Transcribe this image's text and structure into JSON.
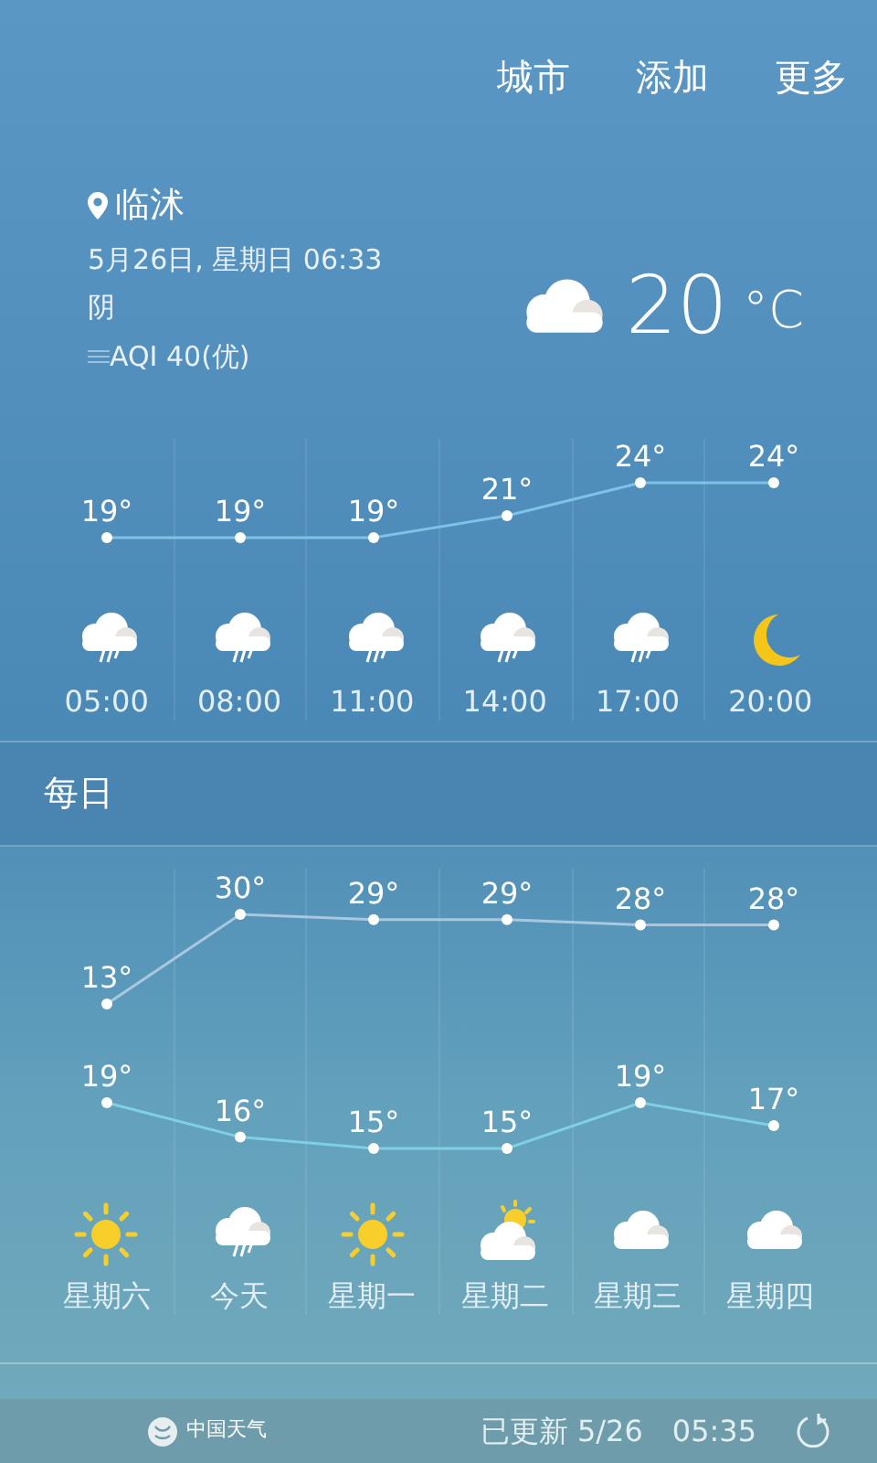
{
  "menu": [
    "城市",
    "添加",
    "更多"
  ],
  "location": {
    "city": "临沭",
    "datetime": "5月26日, 星期日 06:33",
    "condition": "阴",
    "aqi": "AQI 40(优)",
    "temperature": "20",
    "unit": "°C"
  },
  "hourly": {
    "items": [
      {
        "kind": "rain"
      },
      {
        "kind": "rain"
      },
      {
        "kind": "rain"
      },
      {
        "kind": "rain"
      },
      {
        "kind": "rain"
      },
      {
        "kind": "moon"
      }
    ],
    "chart_data": {
      "type": "line",
      "categories": [
        "05:00",
        "08:00",
        "11:00",
        "14:00",
        "17:00",
        "20:00"
      ],
      "series": [
        {
          "color": "#7ec3e6",
          "marker": "circle",
          "values": [
            19,
            19,
            19,
            21,
            24,
            24
          ],
          "value_labels": [
            "19°",
            "19°",
            "19°",
            "21°",
            "24°",
            "24°"
          ]
        }
      ]
    }
  },
  "daily": {
    "title": "每日",
    "items": [
      {
        "kind": "sun"
      },
      {
        "kind": "rain"
      },
      {
        "kind": "sun"
      },
      {
        "kind": "partly"
      },
      {
        "kind": "cloud"
      },
      {
        "kind": "cloud"
      }
    ],
    "high": {
      "chart_data": {
        "type": "line",
        "series": [
          {
            "color": "#a9c8de",
            "marker": "circle",
            "values": [
              13,
              30,
              29,
              29,
              28,
              28
            ],
            "value_labels": [
              "13°",
              "30°",
              "29°",
              "29°",
              "28°",
              "28°"
            ]
          }
        ]
      }
    },
    "low": {
      "chart_data": {
        "type": "line",
        "categories": [
          "星期六",
          "今天",
          "星期一",
          "星期二",
          "星期三",
          "星期四"
        ],
        "series": [
          {
            "color": "#7fd0e0",
            "marker": "circle",
            "values": [
              19,
              16,
              15,
              15,
              19,
              17
            ],
            "value_labels": [
              "19°",
              "16°",
              "15°",
              "15°",
              "19°",
              "17°"
            ]
          }
        ]
      }
    }
  },
  "footer": {
    "logo": "中国天气",
    "updated": "已更新 5/26",
    "time": "05:35"
  }
}
